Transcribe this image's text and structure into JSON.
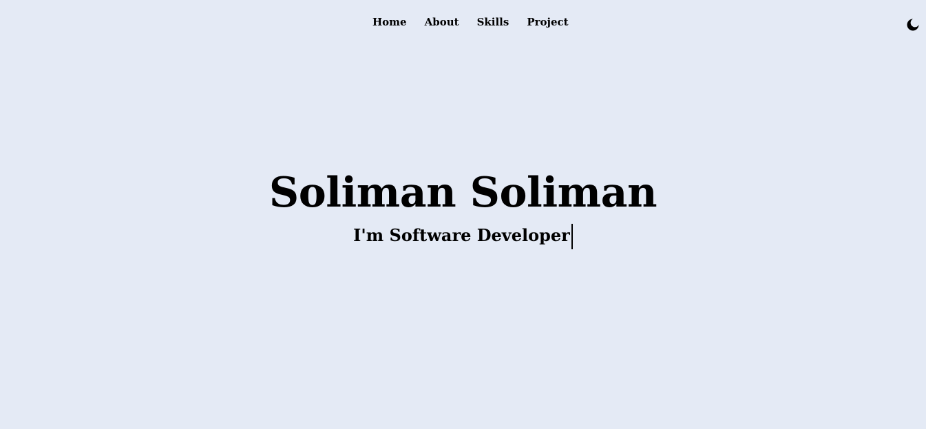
{
  "nav": {
    "items": [
      {
        "label": "Home"
      },
      {
        "label": "About"
      },
      {
        "label": "Skills"
      },
      {
        "label": "Project"
      }
    ]
  },
  "theme_toggle": {
    "icon": "moon-icon"
  },
  "hero": {
    "name": "Soliman Soliman",
    "role": "I'm Software Developer"
  },
  "colors": {
    "background": "#e4eaf5",
    "text": "#000000"
  }
}
